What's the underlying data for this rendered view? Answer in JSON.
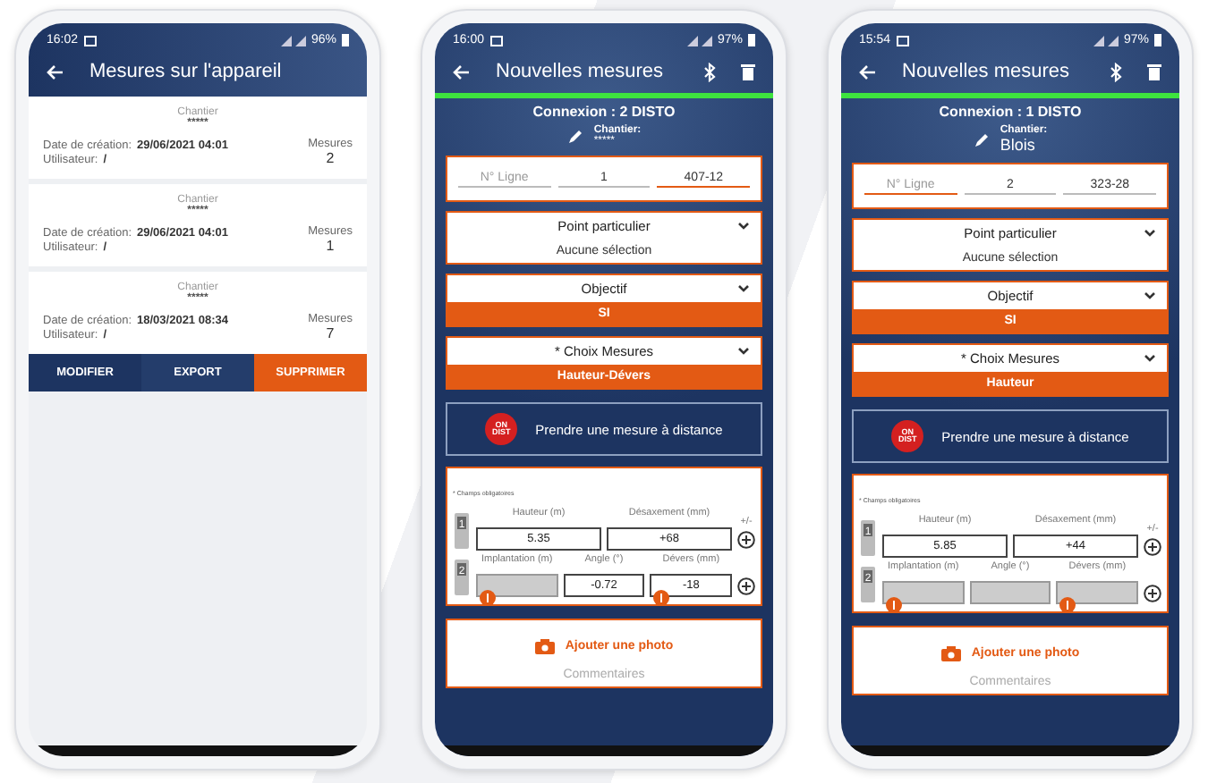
{
  "phones": [
    {
      "kind": "list",
      "status": {
        "time": "16:02",
        "battery": "96%"
      },
      "title": "Mesures sur l'appareil",
      "cards": [
        {
          "site_label": "Chantier",
          "site": "*****",
          "date_label": "Date de création:",
          "date": "29/06/2021 04:01",
          "user_label": "Utilisateur:",
          "user": "/",
          "count_label": "Mesures",
          "count": "2"
        },
        {
          "site_label": "Chantier",
          "site": "*****",
          "date_label": "Date de création:",
          "date": "29/06/2021 04:01",
          "user_label": "Utilisateur:",
          "user": "/",
          "count_label": "Mesures",
          "count": "1"
        },
        {
          "site_label": "Chantier",
          "site": "*****",
          "date_label": "Date de création:",
          "date": "18/03/2021 08:34",
          "user_label": "Utilisateur:",
          "user": "/",
          "count_label": "Mesures",
          "count": "7"
        }
      ],
      "actions": [
        {
          "label": "MODIFIER",
          "danger": false
        },
        {
          "label": "EXPORT",
          "danger": false
        },
        {
          "label": "SUPPRIMER",
          "danger": true
        }
      ]
    },
    {
      "kind": "form",
      "status": {
        "time": "16:00",
        "battery": "97%"
      },
      "title": "Nouvelles mesures",
      "connection": "Connexion : 2 DISTO",
      "site_label": "Chantier:",
      "site": "*****",
      "site_large": false,
      "line_fields": [
        {
          "placeholder": "N° Ligne",
          "focused": false
        },
        {
          "value": "1",
          "focused": false
        },
        {
          "value": "407-12",
          "focused": true
        }
      ],
      "selects": [
        {
          "label": "Point particulier",
          "value": "Aucune sélection",
          "highlighted": false
        },
        {
          "label": "Objectif",
          "value": "SI",
          "highlighted": true
        },
        {
          "label": "* Choix Mesures",
          "value": "Hauteur-Dévers",
          "highlighted": true
        }
      ],
      "remote_button": "Prendre une mesure à distance",
      "remote_badge": [
        "ON",
        "DIST"
      ],
      "required_note": "* Champs obligatoires",
      "sign_header": "+/-",
      "rows": [
        {
          "device": "1",
          "fields": [
            {
              "label": "Hauteur (m)",
              "value": "5.35",
              "disabled": false,
              "info": false
            },
            {
              "label": "Désaxement (mm)",
              "value": "+68",
              "disabled": false,
              "info": false
            }
          ]
        },
        {
          "device": "2",
          "fields": [
            {
              "label": "Implantation (m)",
              "disabled": true,
              "info": true
            },
            {
              "label": "Angle (°)",
              "value": "-0.72",
              "disabled": false,
              "info": false
            },
            {
              "label": "Dévers (mm)",
              "value": "-18",
              "disabled": false,
              "info": true
            }
          ]
        }
      ],
      "photo_button": "Ajouter une photo",
      "comments": "Commentaires"
    },
    {
      "kind": "form",
      "status": {
        "time": "15:54",
        "battery": "97%"
      },
      "title": "Nouvelles mesures",
      "connection": "Connexion : 1 DISTO",
      "site_label": "Chantier:",
      "site": "Blois",
      "site_large": true,
      "line_fields": [
        {
          "placeholder": "N° Ligne",
          "focused": true
        },
        {
          "value": "2",
          "focused": false
        },
        {
          "value": "323-28",
          "focused": false
        }
      ],
      "selects": [
        {
          "label": "Point particulier",
          "value": "Aucune sélection",
          "highlighted": false
        },
        {
          "label": "Objectif",
          "value": "SI",
          "highlighted": true
        },
        {
          "label": "* Choix Mesures",
          "value": "Hauteur",
          "highlighted": true
        }
      ],
      "remote_button": "Prendre une mesure à distance",
      "remote_badge": [
        "ON",
        "DIST"
      ],
      "required_note": "* Champs obligatoires",
      "sign_header": "+/-",
      "rows": [
        {
          "device": "1",
          "fields": [
            {
              "label": "Hauteur (m)",
              "value": "5.85",
              "disabled": false,
              "info": false
            },
            {
              "label": "Désaxement (mm)",
              "value": "+44",
              "disabled": false,
              "info": false
            }
          ]
        },
        {
          "device": "2",
          "fields": [
            {
              "label": "Implantation (m)",
              "disabled": true,
              "info": true
            },
            {
              "label": "Angle (°)",
              "disabled": true,
              "info": false
            },
            {
              "label": "Dévers (mm)",
              "disabled": true,
              "info": true
            }
          ]
        }
      ],
      "photo_button": "Ajouter une photo",
      "comments": "Commentaires"
    }
  ]
}
